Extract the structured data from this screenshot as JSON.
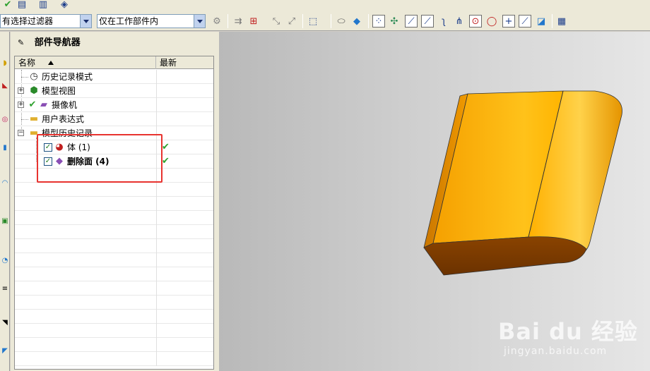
{
  "toolbar": {
    "filter_select": "有选择过滤器",
    "scope_select": "仅在工作部件内"
  },
  "navigator": {
    "title": "部件导航器",
    "columns": {
      "name": "名称",
      "latest": "最新"
    },
    "nodes": [
      {
        "label": "历史记录模式",
        "icon": "clock-icon",
        "expandable": false,
        "level": 0
      },
      {
        "label": "模型视图",
        "icon": "model-views-icon",
        "expandable": true,
        "level": 0
      },
      {
        "label": "摄像机",
        "icon": "camera-icon",
        "expandable": true,
        "level": 0
      },
      {
        "label": "用户表达式",
        "icon": "folder-icon",
        "expandable": false,
        "level": 0
      },
      {
        "label": "模型历史记录",
        "icon": "folder-icon",
        "expandable": true,
        "level": 0
      },
      {
        "label": "体 (1)",
        "icon": "body-feature-icon",
        "checked": true,
        "latest": true,
        "level": 1
      },
      {
        "label": "删除面 (4)",
        "icon": "delete-face-icon",
        "checked": true,
        "latest": true,
        "level": 1
      }
    ]
  },
  "colors": {
    "highlight": "#e8332f",
    "model": "#f5a000",
    "check": "#2ea12e"
  },
  "watermark": {
    "logo": "Bai du 经验",
    "url": "jingyan.baidu.com"
  }
}
